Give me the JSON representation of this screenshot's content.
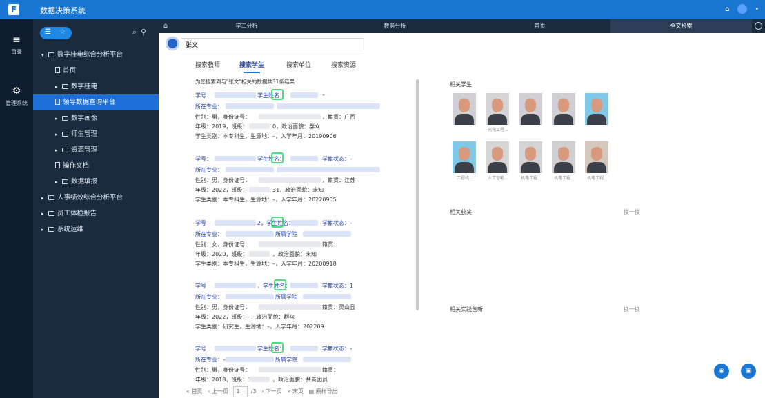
{
  "app": {
    "title": "数据决策系统"
  },
  "rail": {
    "items": [
      {
        "label": "目录",
        "icon": "menu-icon"
      },
      {
        "label": "管理系统",
        "icon": "gear-icon"
      }
    ]
  },
  "sidebar": {
    "tree": [
      {
        "label": "数字桂电综合分析平台",
        "level": 0,
        "type": "folder",
        "expanded": true
      },
      {
        "label": "首页",
        "level": 1,
        "type": "doc"
      },
      {
        "label": "数字桂电",
        "level": 1,
        "type": "folder"
      },
      {
        "label": "领导数据查询平台",
        "level": 1,
        "type": "doc",
        "active": true
      },
      {
        "label": "数字画像",
        "level": 1,
        "type": "folder"
      },
      {
        "label": "师生管理",
        "level": 1,
        "type": "folder"
      },
      {
        "label": "资源管理",
        "level": 1,
        "type": "folder"
      },
      {
        "label": "操作文档",
        "level": 1,
        "type": "doc"
      },
      {
        "label": "数据填报",
        "level": 1,
        "type": "folder"
      },
      {
        "label": "人事绩效综合分析平台",
        "level": 0,
        "type": "folder"
      },
      {
        "label": "员工体检报告",
        "level": 0,
        "type": "folder"
      },
      {
        "label": "系统运维",
        "level": 0,
        "type": "folder"
      }
    ]
  },
  "tabs": [
    {
      "label": "学工分析"
    },
    {
      "label": "教务分析"
    },
    {
      "label": "首页"
    },
    {
      "label": "全文检索",
      "active": true
    }
  ],
  "search": {
    "value": "张文"
  },
  "search_tabs": [
    {
      "label": "搜索教师"
    },
    {
      "label": "搜索学生",
      "active": true
    },
    {
      "label": "搜索单位"
    },
    {
      "label": "搜索资源"
    }
  ],
  "results": {
    "summary": "为您搜索到与\"张文\"相关的数据共31条结果",
    "cards": [
      {
        "row1": "学号：",
        "row1b": "学生姓名：",
        "row1c": "–",
        "row2": "所在专业：",
        "row3a": "性别：男，身份证号：",
        "row3b": "，籍贯：广西",
        "row4": "年级：2019，班级：",
        "row4b": "0，政治面貌：群众",
        "row5": "学生类别：本专科生，生源地：–，入学年月：20190906"
      },
      {
        "row1": "学号：",
        "row1b": "学生姓名：",
        "row1c": "学籍状态：–",
        "row2": "所在专业：",
        "row3a": "性别：男，身份证号：",
        "row3b": "，籍贯：江苏",
        "row4": "年级：2022，班级：",
        "row4b": "31，政治面貌：未知",
        "row5": "学生类别：本专科生，生源地：–，入学年月：20220905"
      },
      {
        "row1": "学号",
        "row1b": "2，学生姓名：",
        "row1c": "学籍状态：–",
        "row2": "所在专业：",
        "row2b": "所属学院",
        "row3a": "性别：女，身份证号：",
        "row3b": "籍贯：",
        "row4": "年级：2020，班级：",
        "row4b": "，政治面貌：未知",
        "row5": "学生类别：本专科生，生源地：–，入学年月：20200918"
      },
      {
        "row1": "学号",
        "row1b": "，学生姓名：",
        "row1c": "学籍状态：1",
        "row2": "所在专业：",
        "row2b": "所属学院",
        "row3a": "性别：男，身份证号：",
        "row3b": "籍贯：灵山县",
        "row4": "年级：2022，班级：–，政治面貌：群众",
        "row4b": "",
        "row5": "学生类别：研究生，生源地：–，入学年月：202209"
      },
      {
        "row1": "学号",
        "row1b": "学生姓名：",
        "row1c": "学籍状态：–",
        "row2": "所在专业：–",
        "row2b": "所属学院",
        "row3a": "性别：男，身份证号：",
        "row3b": "籍贯：",
        "row4": "年级：2018，班级：1",
        "row4b": "，政治面貌：共青团员",
        "row5": ""
      }
    ]
  },
  "right": {
    "related_students_title": "相关学生",
    "student_labels": [
      "",
      "光电工程...",
      "",
      "",
      "",
      "工程机...",
      "人工智能...",
      "机电工程...",
      "机电工程...",
      "机电工程..."
    ],
    "awards_title": "相关获奖",
    "innovation_title": "相关实践创新",
    "refresh_label": "换一换"
  },
  "pager": {
    "first": "首页",
    "prev": "上一页",
    "page": "1",
    "total": "/3",
    "next": "下一页",
    "last": "末页",
    "export": "原样导出"
  },
  "colors": {
    "topbar": "#1976d2",
    "sidebar": "#1a2b3e",
    "active": "#1e6fd9",
    "highlight": "#4ade80"
  }
}
